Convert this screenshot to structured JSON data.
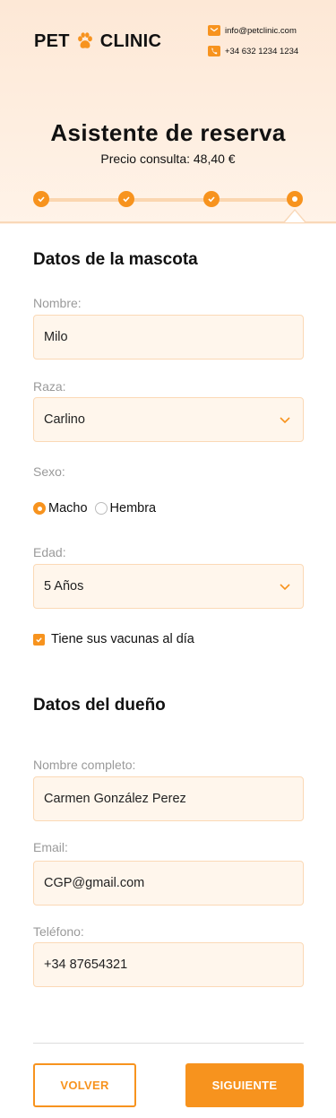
{
  "brand": {
    "name_left": "PET",
    "name_right": "CLINIC",
    "accent_color": "#f7931e"
  },
  "contact": {
    "email": "info@petclinic.com",
    "phone": "+34 632 1234 1234"
  },
  "wizard": {
    "title": "Asistente de reserva",
    "price": "Precio consulta: 48,40 €",
    "steps": [
      {
        "status": "completed"
      },
      {
        "status": "completed"
      },
      {
        "status": "completed"
      },
      {
        "status": "current"
      }
    ]
  },
  "pet": {
    "section_title": "Datos de la mascota",
    "name_label": "Nombre:",
    "name_value": "Milo",
    "breed_label": "Raza:",
    "breed_value": "Carlino",
    "sex_label": "Sexo:",
    "sex_options": [
      "Macho",
      "Hembra"
    ],
    "sex_selected": "Macho",
    "age_label": "Edad:",
    "age_value": "5 Años",
    "vaccines_label": "Tiene sus vacunas al día",
    "vaccines_checked": true
  },
  "owner": {
    "section_title": "Datos del dueño",
    "fullname_label": "Nombre completo:",
    "fullname_value": "Carmen González Perez",
    "email_label": "Email:",
    "email_value": "CGP@gmail.com",
    "phone_label": "Teléfono:",
    "phone_value": "+34 87654321"
  },
  "actions": {
    "back_label": "VOLVER",
    "next_label": "SIGUIENTE"
  }
}
